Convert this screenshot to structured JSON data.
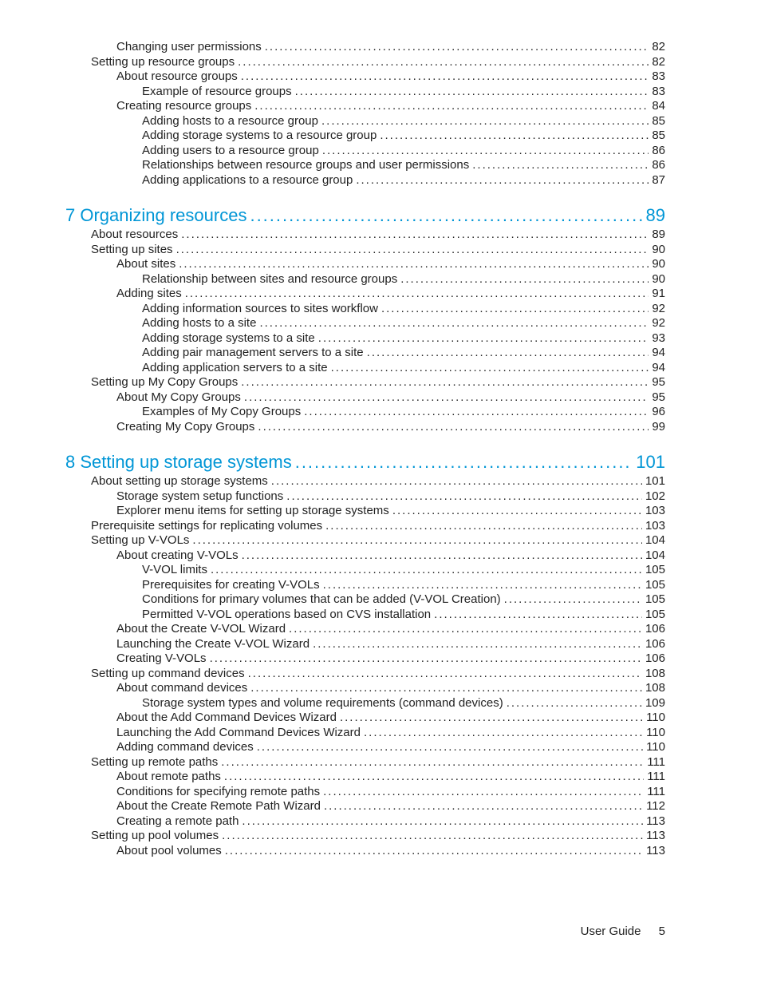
{
  "footer": {
    "label": "User Guide",
    "page": "5"
  },
  "toc": [
    {
      "level": 2,
      "chapter": false,
      "label": "Changing user permissions",
      "page": "82"
    },
    {
      "level": 1,
      "chapter": false,
      "label": "Setting up resource groups",
      "page": "82"
    },
    {
      "level": 2,
      "chapter": false,
      "label": "About resource groups",
      "page": "83"
    },
    {
      "level": 3,
      "chapter": false,
      "label": "Example of resource groups",
      "page": "83"
    },
    {
      "level": 2,
      "chapter": false,
      "label": "Creating resource groups",
      "page": "84"
    },
    {
      "level": 3,
      "chapter": false,
      "label": "Adding hosts to a resource group",
      "page": "85"
    },
    {
      "level": 3,
      "chapter": false,
      "label": "Adding storage systems to a resource group",
      "page": "85"
    },
    {
      "level": 3,
      "chapter": false,
      "label": "Adding users to a resource group",
      "page": "86"
    },
    {
      "level": 3,
      "chapter": false,
      "label": "Relationships between resource groups and user permissions",
      "page": "86"
    },
    {
      "level": 3,
      "chapter": false,
      "label": "Adding applications to a resource group",
      "page": "87"
    },
    {
      "level": 0,
      "chapter": true,
      "label": "7 Organizing resources",
      "page": "89"
    },
    {
      "level": 1,
      "chapter": false,
      "label": "About resources",
      "page": "89"
    },
    {
      "level": 1,
      "chapter": false,
      "label": "Setting up sites",
      "page": "90"
    },
    {
      "level": 2,
      "chapter": false,
      "label": "About sites",
      "page": "90"
    },
    {
      "level": 3,
      "chapter": false,
      "label": "Relationship between sites and resource groups",
      "page": "90"
    },
    {
      "level": 2,
      "chapter": false,
      "label": "Adding sites",
      "page": "91"
    },
    {
      "level": 3,
      "chapter": false,
      "label": "Adding information sources to sites workflow",
      "page": "92"
    },
    {
      "level": 3,
      "chapter": false,
      "label": "Adding hosts to a site",
      "page": "92"
    },
    {
      "level": 3,
      "chapter": false,
      "label": "Adding storage systems to a site",
      "page": "93"
    },
    {
      "level": 3,
      "chapter": false,
      "label": "Adding pair management servers to a site",
      "page": "94"
    },
    {
      "level": 3,
      "chapter": false,
      "label": "Adding application servers to a site",
      "page": "94"
    },
    {
      "level": 1,
      "chapter": false,
      "label": "Setting up My Copy Groups",
      "page": "95"
    },
    {
      "level": 2,
      "chapter": false,
      "label": "About My Copy Groups",
      "page": "95"
    },
    {
      "level": 3,
      "chapter": false,
      "label": "Examples of My Copy Groups",
      "page": "96"
    },
    {
      "level": 2,
      "chapter": false,
      "label": "Creating My Copy Groups",
      "page": "99"
    },
    {
      "level": 0,
      "chapter": true,
      "label": "8 Setting up storage systems",
      "page": "101"
    },
    {
      "level": 1,
      "chapter": false,
      "label": "About setting up storage systems",
      "page": "101"
    },
    {
      "level": 2,
      "chapter": false,
      "label": "Storage system setup functions",
      "page": "102"
    },
    {
      "level": 2,
      "chapter": false,
      "label": "Explorer menu items for setting up storage systems",
      "page": "103"
    },
    {
      "level": 1,
      "chapter": false,
      "label": "Prerequisite settings for replicating volumes",
      "page": "103"
    },
    {
      "level": 1,
      "chapter": false,
      "label": "Setting up V-VOLs",
      "page": "104"
    },
    {
      "level": 2,
      "chapter": false,
      "label": "About creating V-VOLs",
      "page": "104"
    },
    {
      "level": 3,
      "chapter": false,
      "label": "V-VOL limits",
      "page": "105"
    },
    {
      "level": 3,
      "chapter": false,
      "label": "Prerequisites for creating V-VOLs",
      "page": "105"
    },
    {
      "level": 3,
      "chapter": false,
      "label": "Conditions for primary volumes that can be added (V-VOL Creation)",
      "page": "105"
    },
    {
      "level": 3,
      "chapter": false,
      "label": "Permitted V-VOL operations based on CVS installation",
      "page": "105"
    },
    {
      "level": 2,
      "chapter": false,
      "label": "About the Create V-VOL Wizard",
      "page": "106"
    },
    {
      "level": 2,
      "chapter": false,
      "label": "Launching the Create V-VOL Wizard",
      "page": "106"
    },
    {
      "level": 2,
      "chapter": false,
      "label": "Creating V-VOLs",
      "page": "106"
    },
    {
      "level": 1,
      "chapter": false,
      "label": "Setting up command devices",
      "page": "108"
    },
    {
      "level": 2,
      "chapter": false,
      "label": "About command devices",
      "page": "108"
    },
    {
      "level": 3,
      "chapter": false,
      "label": "Storage system types and volume requirements (command devices)",
      "page": "109"
    },
    {
      "level": 2,
      "chapter": false,
      "label": "About the Add Command Devices Wizard",
      "page": "110"
    },
    {
      "level": 2,
      "chapter": false,
      "label": "Launching the Add Command Devices Wizard",
      "page": "110"
    },
    {
      "level": 2,
      "chapter": false,
      "label": "Adding command devices",
      "page": "110"
    },
    {
      "level": 1,
      "chapter": false,
      "label": "Setting up remote paths",
      "page": "111"
    },
    {
      "level": 2,
      "chapter": false,
      "label": "About remote paths",
      "page": "111"
    },
    {
      "level": 2,
      "chapter": false,
      "label": "Conditions for specifying remote paths",
      "page": "111"
    },
    {
      "level": 2,
      "chapter": false,
      "label": "About the Create Remote Path Wizard",
      "page": "112"
    },
    {
      "level": 2,
      "chapter": false,
      "label": "Creating a remote path",
      "page": "113"
    },
    {
      "level": 1,
      "chapter": false,
      "label": "Setting up pool volumes",
      "page": "113"
    },
    {
      "level": 2,
      "chapter": false,
      "label": "About pool volumes",
      "page": "113"
    }
  ]
}
